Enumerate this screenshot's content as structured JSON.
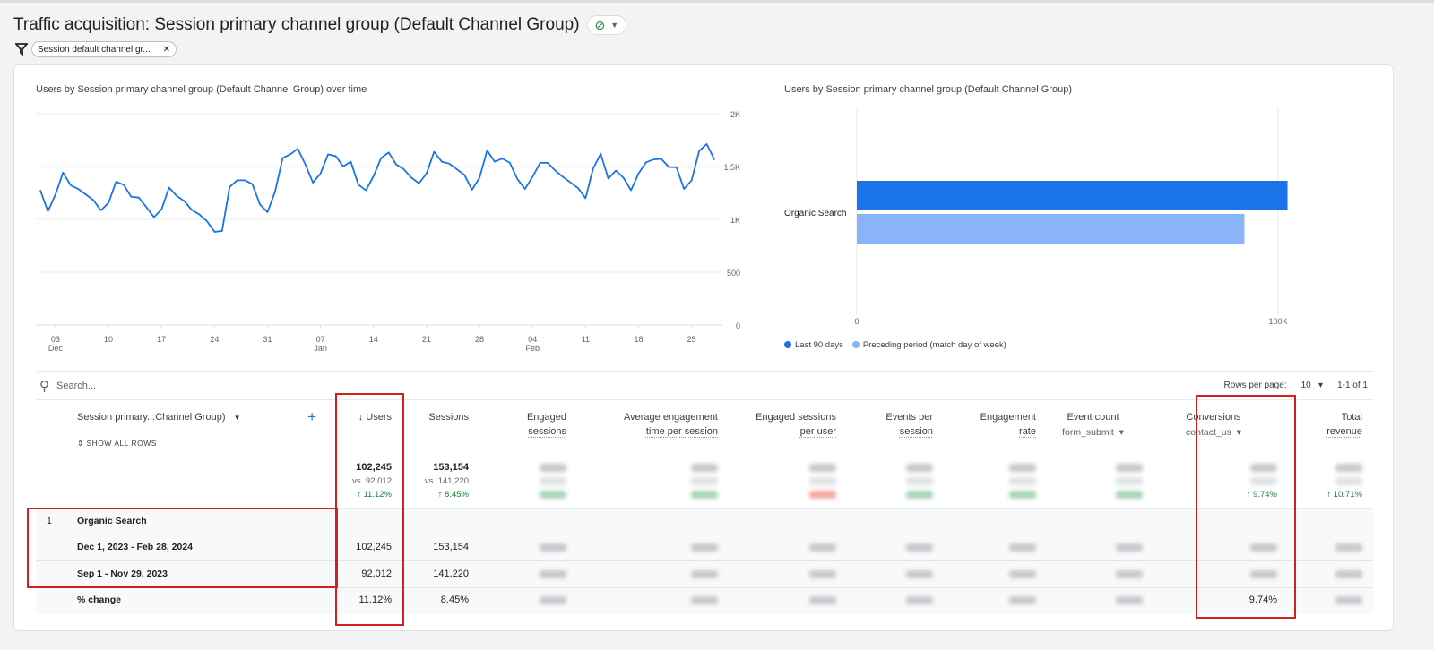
{
  "header": {
    "title": "Traffic acquisition: Session primary channel group (Default Channel Group)",
    "status_icon": "check-circle-icon",
    "filter_chip": "Session default channel gr..."
  },
  "line_chart_title": "Users by Session primary channel group (Default Channel Group) over time",
  "bar_chart_title": "Users by Session primary channel group (Default Channel Group)",
  "chart_data": [
    {
      "type": "line",
      "title": "Users by Session primary channel group (Default Channel Group) over time",
      "x_start": "Dec 1, 2023",
      "x_end": "Feb 28, 2024",
      "x_interval": "day",
      "x_ticks": [
        {
          "day": "03",
          "month": "Dec",
          "index": 2
        },
        {
          "day": "10",
          "index": 9
        },
        {
          "day": "17",
          "index": 16
        },
        {
          "day": "24",
          "index": 23
        },
        {
          "day": "31",
          "index": 30
        },
        {
          "day": "07",
          "month": "Jan",
          "index": 37
        },
        {
          "day": "14",
          "index": 44
        },
        {
          "day": "21",
          "index": 51
        },
        {
          "day": "28",
          "index": 58
        },
        {
          "day": "04",
          "month": "Feb",
          "index": 65
        },
        {
          "day": "11",
          "index": 72
        },
        {
          "day": "18",
          "index": 79
        },
        {
          "day": "25",
          "index": 86
        }
      ],
      "y_ticks": [
        "0",
        "500",
        "1K",
        "1.5K",
        "2K"
      ],
      "ylim": [
        0,
        2000
      ],
      "grid": true,
      "color": "#1a73e8",
      "values": [
        1275,
        1076,
        1235,
        1442,
        1323,
        1288,
        1235,
        1182,
        1086,
        1155,
        1355,
        1328,
        1214,
        1206,
        1116,
        1020,
        1094,
        1301,
        1222,
        1174,
        1089,
        1046,
        983,
        882,
        890,
        1307,
        1370,
        1370,
        1333,
        1142,
        1068,
        1262,
        1580,
        1615,
        1668,
        1519,
        1347,
        1434,
        1615,
        1599,
        1501,
        1546,
        1328,
        1275,
        1408,
        1580,
        1633,
        1519,
        1474,
        1394,
        1341,
        1434,
        1639,
        1546,
        1527,
        1474,
        1421,
        1280,
        1394,
        1652,
        1546,
        1575,
        1535,
        1381,
        1288,
        1402,
        1535,
        1535,
        1461,
        1402,
        1349,
        1296,
        1200,
        1482,
        1620,
        1386,
        1461,
        1394,
        1275,
        1434,
        1540,
        1567,
        1572,
        1495,
        1493,
        1288,
        1368,
        1647,
        1713,
        1567
      ]
    },
    {
      "type": "bar",
      "orientation": "horizontal",
      "title": "Users by Session primary channel group (Default Channel Group)",
      "categories": [
        "Organic Search"
      ],
      "series": [
        {
          "name": "Last 90 days",
          "values": [
            102245
          ],
          "color": "#1a73e8"
        },
        {
          "name": "Preceding period (match day of week)",
          "values": [
            92012
          ],
          "color": "#8ab4f8"
        }
      ],
      "x_ticks": [
        "0",
        "100K"
      ],
      "xlim": [
        0,
        100000
      ],
      "legend": "bottom-left"
    }
  ],
  "table": {
    "search_placeholder": "Search...",
    "rows_per_page_label": "Rows per page:",
    "rows_per_page": "10",
    "range": "1-1 of 1",
    "dimension_header": "Session primary...Channel Group)",
    "show_all_rows": "SHOW ALL ROWS",
    "columns": [
      {
        "label": "↓ Users"
      },
      {
        "label": "Sessions"
      },
      {
        "label": "Engaged sessions"
      },
      {
        "label": "Average engagement time per session"
      },
      {
        "label": "Engaged sessions per user"
      },
      {
        "label": "Events per session"
      },
      {
        "label": "Engagement rate"
      },
      {
        "label": "Event count",
        "sub": "form_submit"
      },
      {
        "label": "Conversions",
        "sub": "contact_us"
      },
      {
        "label": "Total revenue"
      }
    ],
    "totals": {
      "users": "102,245",
      "users_vs": "vs. 92,012",
      "users_change": "↑ 11.12%",
      "sessions": "153,154",
      "sessions_vs": "vs. 141,220",
      "sessions_change": "↑ 8.45%",
      "conversions_change": "↑ 9.74%",
      "revenue_change": "↑ 10.71%"
    },
    "rows": [
      {
        "index": "1",
        "label": "Organic Search"
      },
      {
        "label": "Dec 1, 2023 - Feb 28, 2024",
        "users": "102,245",
        "sessions": "153,154"
      },
      {
        "label": "Sep 1 - Nov 29, 2023",
        "users": "92,012",
        "sessions": "141,220"
      },
      {
        "label": "% change",
        "users": "11.12%",
        "sessions": "8.45%",
        "conversions": "9.74%"
      }
    ]
  },
  "annotation_color": "#d21f1f"
}
